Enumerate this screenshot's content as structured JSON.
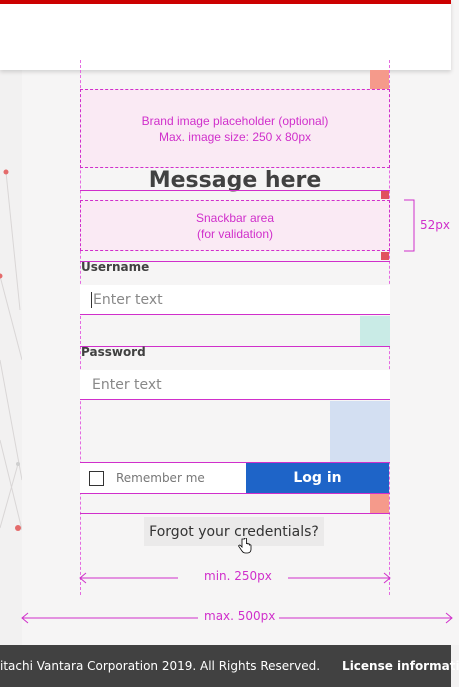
{
  "brand_placeholder": {
    "line1": "Brand image placeholder (optional)",
    "line2": "Max. image size: 250 x 80px"
  },
  "message": "Message here",
  "snackbar": {
    "line1": "Snackbar area",
    "line2": "(for validation)",
    "height_label": "52px"
  },
  "username": {
    "label": "Username",
    "placeholder": "Enter text"
  },
  "password": {
    "label": "Password",
    "placeholder": "Enter text"
  },
  "remember_label": "Remember me",
  "login_label": "Log in",
  "forgot_label": "Forgot your credentials?",
  "dimensions": {
    "min_width": "min. 250px",
    "max_width": "max. 500px"
  },
  "footer": {
    "copyright": "itachi Vantara Corporation 2019. All Rights Reserved.",
    "license": "License information"
  },
  "colors": {
    "accent_red": "#cc0000",
    "guide_magenta": "#d02fcb",
    "primary_blue": "#1e64c8",
    "footer_bg": "#414141"
  }
}
